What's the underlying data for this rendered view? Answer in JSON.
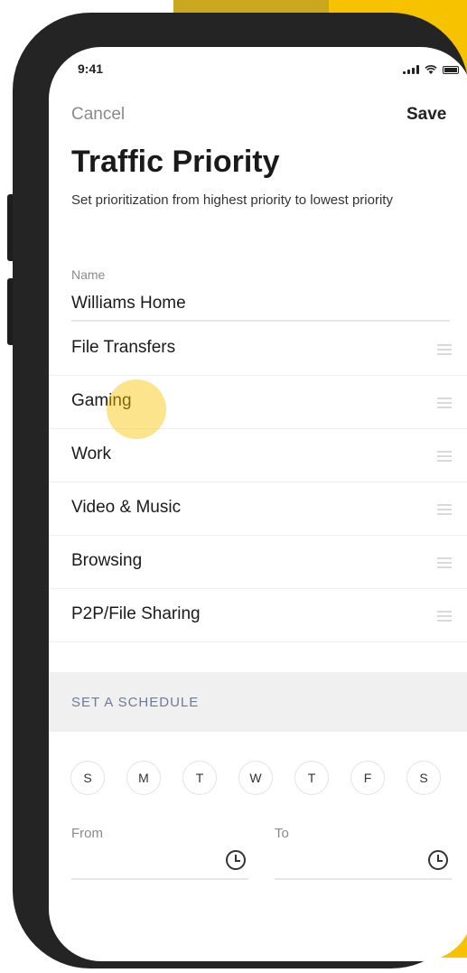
{
  "status_bar": {
    "time": "9:41"
  },
  "header": {
    "cancel": "Cancel",
    "save": "Save"
  },
  "page": {
    "title": "Traffic Priority",
    "subtitle": "Set prioritization from highest priority to lowest priority"
  },
  "name_field": {
    "label": "Name",
    "value": "Williams Home"
  },
  "priority_list": [
    {
      "label": "File Transfers"
    },
    {
      "label": "Gaming"
    },
    {
      "label": "Work"
    },
    {
      "label": "Video & Music"
    },
    {
      "label": "Browsing"
    },
    {
      "label": "P2P/File Sharing"
    }
  ],
  "schedule": {
    "section_label": "SET A SCHEDULE",
    "days": [
      "S",
      "M",
      "T",
      "W",
      "T",
      "F",
      "S"
    ],
    "from_label": "From",
    "to_label": "To"
  },
  "icons": {
    "signal": "signal-icon",
    "wifi": "wifi-icon",
    "battery": "battery-icon",
    "drag_handle": "drag-handle-icon",
    "clock": "clock-icon"
  },
  "colors": {
    "accent_yellow": "#f7c300",
    "phone_frame": "#242424",
    "section_bg": "#f0f0f0",
    "section_text": "#6f7a96"
  }
}
